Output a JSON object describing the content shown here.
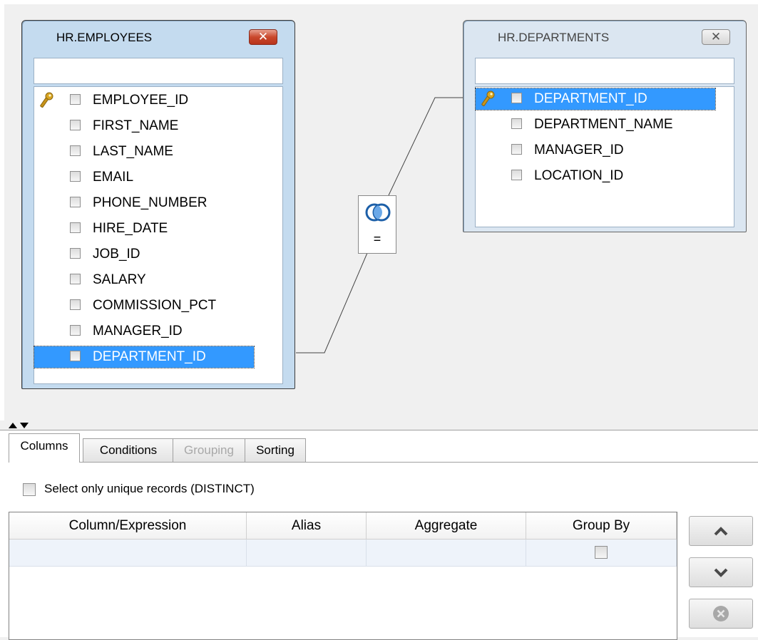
{
  "designer": {
    "tables": [
      {
        "title": "HR.EMPLOYEES",
        "close_glyph": "✕",
        "fields": [
          {
            "name": "EMPLOYEE_ID",
            "is_key": true,
            "selected": false
          },
          {
            "name": "FIRST_NAME",
            "is_key": false,
            "selected": false
          },
          {
            "name": "LAST_NAME",
            "is_key": false,
            "selected": false
          },
          {
            "name": "EMAIL",
            "is_key": false,
            "selected": false
          },
          {
            "name": "PHONE_NUMBER",
            "is_key": false,
            "selected": false
          },
          {
            "name": "HIRE_DATE",
            "is_key": false,
            "selected": false
          },
          {
            "name": "JOB_ID",
            "is_key": false,
            "selected": false
          },
          {
            "name": "SALARY",
            "is_key": false,
            "selected": false
          },
          {
            "name": "COMMISSION_PCT",
            "is_key": false,
            "selected": false
          },
          {
            "name": "MANAGER_ID",
            "is_key": false,
            "selected": false
          },
          {
            "name": "DEPARTMENT_ID",
            "is_key": false,
            "selected": true
          }
        ]
      },
      {
        "title": "HR.DEPARTMENTS",
        "close_glyph": "✕",
        "fields": [
          {
            "name": "DEPARTMENT_ID",
            "is_key": true,
            "selected": true
          },
          {
            "name": "DEPARTMENT_NAME",
            "is_key": false,
            "selected": false
          },
          {
            "name": "MANAGER_ID",
            "is_key": false,
            "selected": false
          },
          {
            "name": "LOCATION_ID",
            "is_key": false,
            "selected": false
          }
        ]
      }
    ],
    "join": {
      "operator": "=",
      "icon": "inner-join-icon"
    }
  },
  "lower_panel": {
    "tabs": [
      {
        "label": "Columns",
        "active": true,
        "disabled": false
      },
      {
        "label": "Conditions",
        "active": false,
        "disabled": false
      },
      {
        "label": "Grouping",
        "active": false,
        "disabled": true
      },
      {
        "label": "Sorting",
        "active": false,
        "disabled": false
      }
    ],
    "distinct_label": "Select only unique records (DISTINCT)",
    "grid": {
      "headers": [
        "Column/Expression",
        "Alias",
        "Aggregate",
        "Group By"
      ],
      "rows": [
        {
          "column": "",
          "alias": "",
          "aggregate": "",
          "group_by": false
        }
      ]
    },
    "side_buttons": [
      "move-up-icon",
      "move-down-icon",
      "remove-icon"
    ]
  }
}
